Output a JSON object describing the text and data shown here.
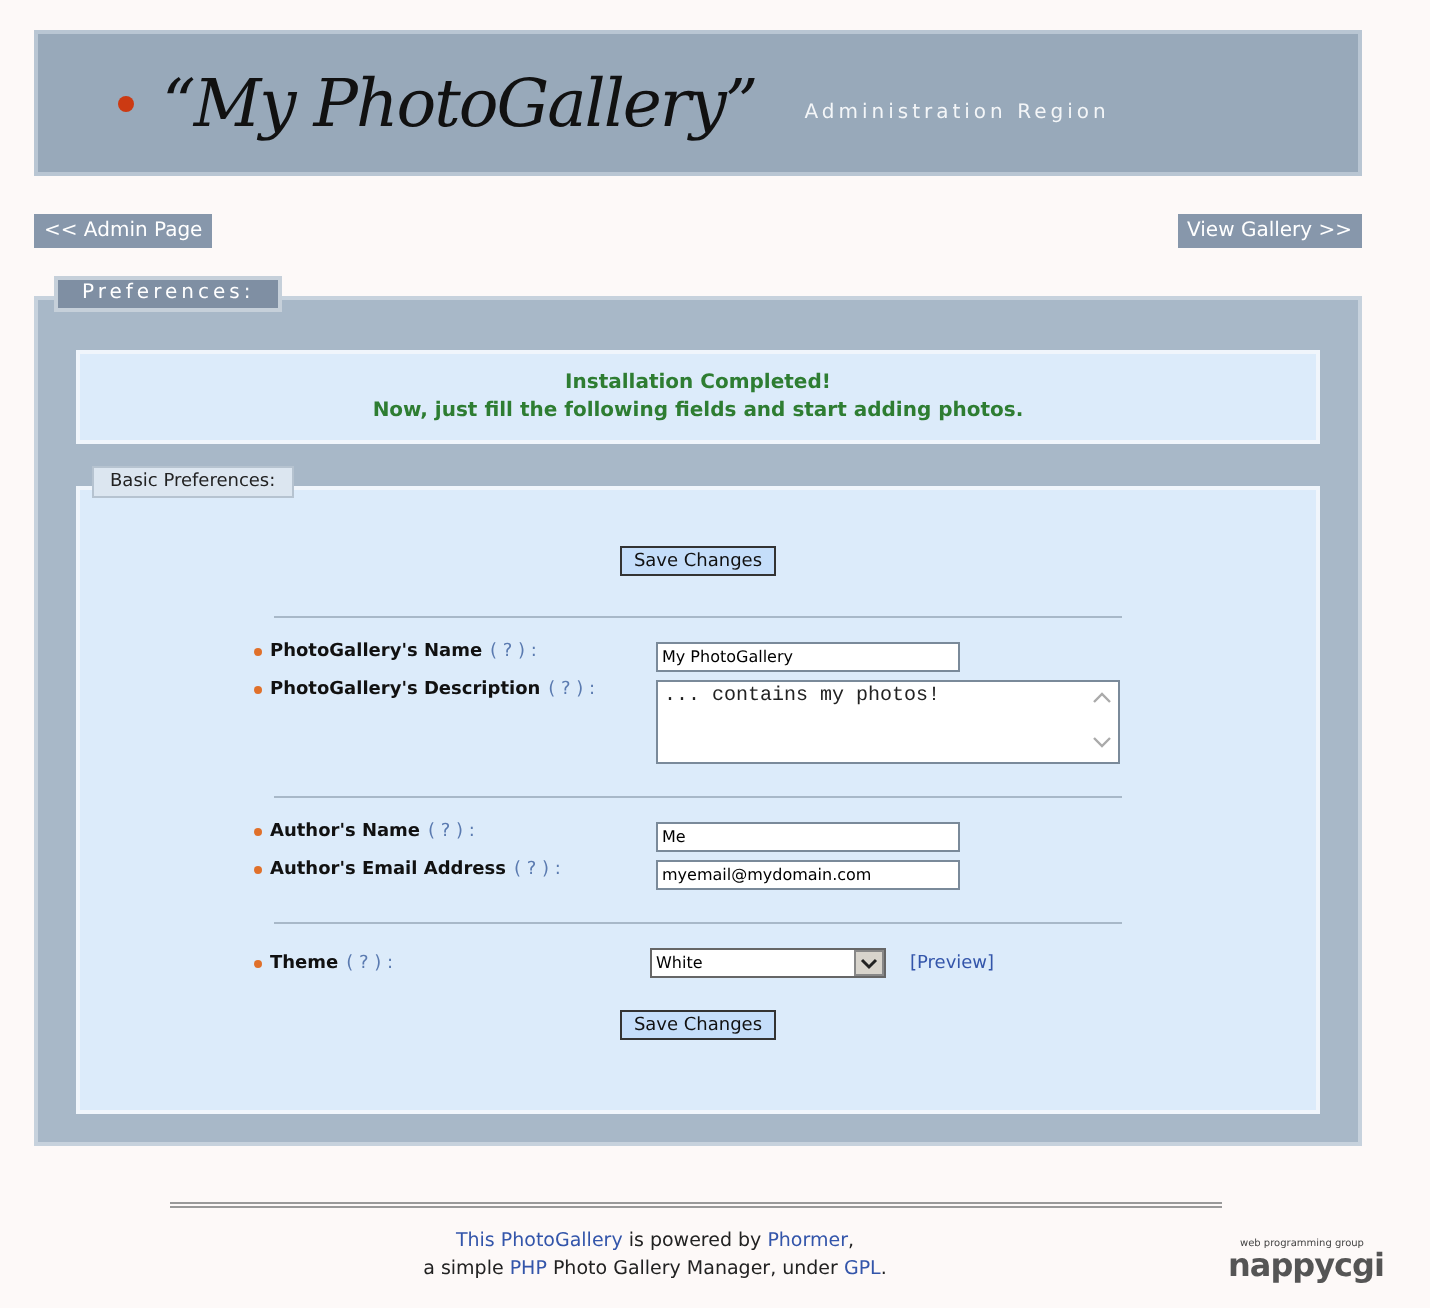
{
  "header": {
    "title": "“My PhotoGallery”",
    "subtitle": "Administration Region"
  },
  "nav": {
    "back": "<< Admin Page",
    "forward": "View Gallery >>"
  },
  "panel": {
    "tab": "Preferences:",
    "message": [
      "Installation Completed!",
      "Now, just fill the following fields and start adding photos."
    ],
    "section": {
      "tab": "Basic Preferences:",
      "save_top": "Save Changes",
      "save_bottom": "Save Changes",
      "groups": [
        [
          {
            "kind": "text",
            "label": "PhotoGallery's Name",
            "help": "( ? ) :",
            "value": "My PhotoGallery"
          },
          {
            "kind": "textarea",
            "label": "PhotoGallery's Description",
            "help": "( ? ) :",
            "value": "... contains my photos!"
          }
        ],
        [
          {
            "kind": "text",
            "label": "Author's Name",
            "help": "( ? ) :",
            "value": "Me"
          },
          {
            "kind": "text",
            "label": "Author's Email Address",
            "help": "( ? ) :",
            "value": "myemail@mydomain.com"
          }
        ],
        [
          {
            "kind": "select",
            "label": "Theme",
            "help": "( ? ) :",
            "value": "White",
            "link": "[Preview]"
          }
        ]
      ]
    }
  },
  "footer": {
    "line1": [
      "This PhotoGallery",
      " is powered by ",
      "Phormer",
      ","
    ],
    "line2": [
      "a simple ",
      "PHP",
      " Photo Gallery Manager, under ",
      "GPL",
      "."
    ],
    "logo": {
      "tagline": "web programming group",
      "name": "nappycgi"
    }
  }
}
